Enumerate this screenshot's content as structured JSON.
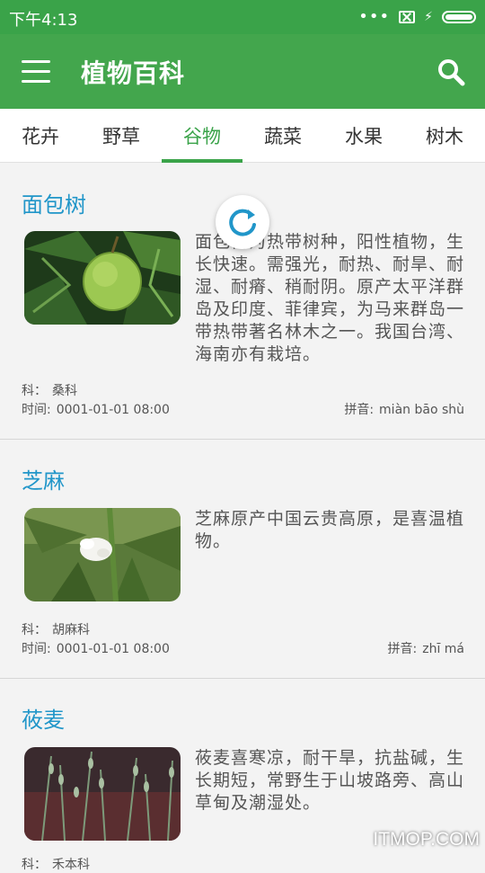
{
  "status_bar": {
    "time": "下午4:13",
    "dots": "•••"
  },
  "app_bar": {
    "title": "植物百科"
  },
  "tabs": [
    {
      "label": "花卉"
    },
    {
      "label": "野草"
    },
    {
      "label": "谷物"
    },
    {
      "label": "蔬菜"
    },
    {
      "label": "水果"
    },
    {
      "label": "树木"
    }
  ],
  "active_tab": "谷物",
  "items": [
    {
      "name": "面包树",
      "description": "面包树为热带树种，阳性植物，生长快速。需强光，耐热、耐旱、耐湿、耐瘠、稍耐阴。原产太平洋群岛及印度、菲律宾，为马来群岛一带热带著名林木之一。我国台湾、海南亦有栽培。",
      "family_label": "科：",
      "family": "桑科",
      "time_label": "时间:",
      "time": "0001-01-01 08:00",
      "pinyin_label": "拼音:",
      "pinyin": "miàn bāo shù"
    },
    {
      "name": "芝麻",
      "description": "芝麻原产中国云贵高原，是喜温植物。",
      "family_label": "科：",
      "family": "胡麻科",
      "time_label": "时间:",
      "time": "0001-01-01 08:00",
      "pinyin_label": "拼音:",
      "pinyin": "zhī má"
    },
    {
      "name": "莜麦",
      "description": "莜麦喜寒凉，耐干旱，抗盐碱，生长期短，常野生于山坡路旁、高山草甸及潮湿处。",
      "family_label": "科：",
      "family": "禾本科"
    }
  ],
  "watermark": "ITMOP.COM",
  "colors": {
    "primary": "#43a64d",
    "title_blue": "#2196c9",
    "accent": "#3aa349"
  }
}
